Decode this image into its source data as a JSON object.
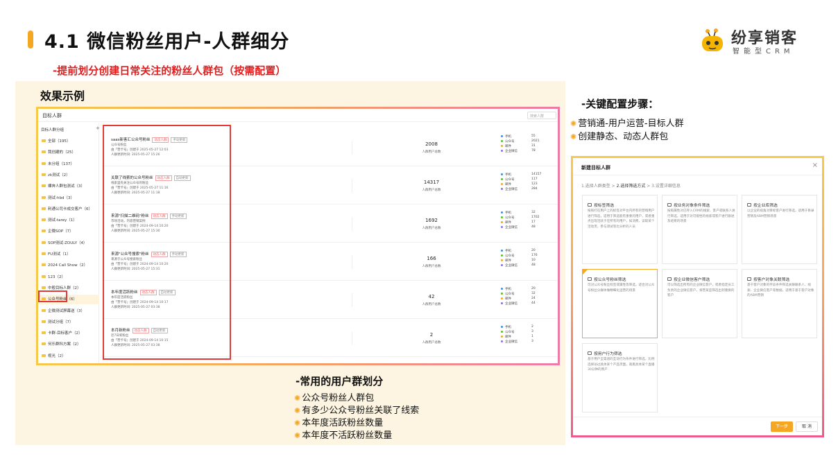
{
  "header": {
    "title": "4.1 微信粉丝用户-人群细分",
    "subtitle": "-提前划分创建日常关注的粉丝人群包（按需配置）",
    "logo_text": "纷享销客",
    "logo_sub": "智能型CRM"
  },
  "effect_label": "效果示例",
  "screen": {
    "title": "目标人群",
    "search_placeholder": "搜索人群",
    "sidebar_head": "目标人群分组",
    "sidebar_plus": "+",
    "sidebar_items": [
      "全部（195）",
      "我创建的（25）",
      "未分组（137）",
      "zk测试（2）",
      "裸奔人群包测试（3）",
      "测试-hbd（3）",
      "利通公司卡成交客户（6）",
      "测试-tarey（1）",
      "企微SOP（7）",
      "SOP测试-ZOULY（4）",
      "FU测试（1）",
      "2024 Call Show（2）",
      "123（2）",
      "中般目标人群（2）",
      "公众号粉丝（6）",
      "企微测试屏幕送（3）",
      "测试分组（7）",
      "卡群-目标客户（2）",
      "何乐群科方案（2）",
      "视光（2）",
      "分群管理（2）"
    ],
    "rows": [
      {
        "name": "saas新客汇公众号粉丝",
        "tag1": "动态人群",
        "tag2": "手动更新",
        "l1": "公众号粉丝",
        "l2": "由「营卡号」创建于 2025-05-27 12:03",
        "l3": "人群更新时间: 2025-05-27 15:26",
        "count": "2008",
        "stats": [
          "55",
          "2021",
          "31",
          "78"
        ]
      },
      {
        "name": "关联了线索的公众号粉丝",
        "tag1": "动态人群",
        "tag2": "自动更新",
        "l1": "线索里有关注公众号的粉丝",
        "l2": "由「营卡号」创建于 2025-05-27 11:16",
        "l3": "人群更新时间: 2025-05-27 11:18",
        "count": "14317",
        "stats": [
          "14157",
          "117",
          "123",
          "284"
        ]
      },
      {
        "name": "来源\"扫描二维码\"粉丝",
        "tag1": "动态人群",
        "tag2": "手动更新",
        "l1": "市场活动，内容营销案例",
        "l2": "由「营卡号」创建于 2024-09-14 10:20",
        "l3": "人群更新时间: 2025-05-27 15:30",
        "count": "1692",
        "stats": [
          "32",
          "1702",
          "17",
          "48"
        ]
      },
      {
        "name": "来源\"公众号搜索\"粉丝",
        "tag1": "动态人群",
        "tag2": "手动更新",
        "l1": "来源于公众号搜索粉丝",
        "l2": "由「营卡号」创建于 2024-09-14 10:20",
        "l3": "人群更新时间: 2025-05-27 15:31",
        "count": "166",
        "stats": [
          "20",
          "176",
          "10",
          "48"
        ]
      },
      {
        "name": "本年度活跃粉丝",
        "tag1": "动态人群",
        "tag2": "自动更新",
        "l1": "本年度活跃粉丝",
        "l2": "由「营卡号」创建于 2024-09-14 10:17",
        "l3": "人群更新时间: 2025-05-27 03:38",
        "count": "42",
        "stats": [
          "20",
          "32",
          "24",
          "44"
        ]
      },
      {
        "name": "本月新粉丝",
        "tag1": "动态人群",
        "tag2": "自动更新",
        "l1": "近7日新粉丝",
        "l2": "由「营卡号」创建于 2024-09-14 10:15",
        "l3": "人群更新时间: 2025-05-27 03:38",
        "count": "2",
        "stats": [
          "2",
          "3",
          "1",
          "3"
        ]
      }
    ],
    "count_label": "人群用户总数",
    "stat_labels": [
      "手机",
      "公众号",
      "邮件",
      "企业微信"
    ],
    "stat_colors": [
      "#3a8ee6",
      "#52c41a",
      "#f5a623",
      "#8a6de9"
    ]
  },
  "groups": {
    "title": "-常用的用户群划分",
    "items": [
      "公众号粉丝人群包",
      "有多少公众号粉丝关联了线索",
      "本年度活跃粉丝数量",
      "本年度不活跃粉丝数量"
    ]
  },
  "steps": {
    "title": "-关键配置步骤：",
    "items": [
      "营销通-用户运营-目标人群",
      "创建静态、动态人群包"
    ]
  },
  "modal": {
    "title": "新建目标人群",
    "close": "×",
    "step1": "1.选择人群类型 >",
    "step2": "2.选择筛选方式",
    "step3": "> 3.设置详细信息",
    "cards": [
      {
        "title": "按标签筛选",
        "desc": "按照打在用户上的标签对平台内所有的营销用户进行筛选，适用于筛选能有重要的用户，或者重点出现活跃于在所有的用户，如消费，读取某个活动页，参与测试等比分析的人员"
      },
      {
        "title": "按业务对象条件筛选",
        "desc": "按照属性对已存入CRM的线索、客户或联系人进行筛选，适用于对可能性的线索或客户进行跟进及培育的场景"
      },
      {
        "title": "按企业库筛选",
        "desc": "以企业的视角对目标客户进行筛选，适用于目录营销及ABM营销场景"
      },
      {
        "title": "按公众号粉丝筛选",
        "desc": "可对公众号粉丝标签或属性等筛选，适合对公众号粉丝分群体做精细化运营的场景"
      },
      {
        "title": "按企业微信客户筛选",
        "desc": "可以筛选出所有的企业微信客户，或者指定员工负责的企业微信客户，将营某些筛选出到重要的客户"
      },
      {
        "title": "按客户对象关联筛选",
        "desc": "基于客户对象的字段条件筛选关联联系人、线索、企业微信客户等数据，适用于基于客户对象的ABM营销"
      },
      {
        "title": "按用户行为筛选",
        "desc": "基于用户全渠道的互动行为条件进行筛选，比例选择访过具体某个产品页面，观看具体某个直播30分钟的用户"
      }
    ],
    "next": "下一步",
    "cancel": "取 消"
  }
}
